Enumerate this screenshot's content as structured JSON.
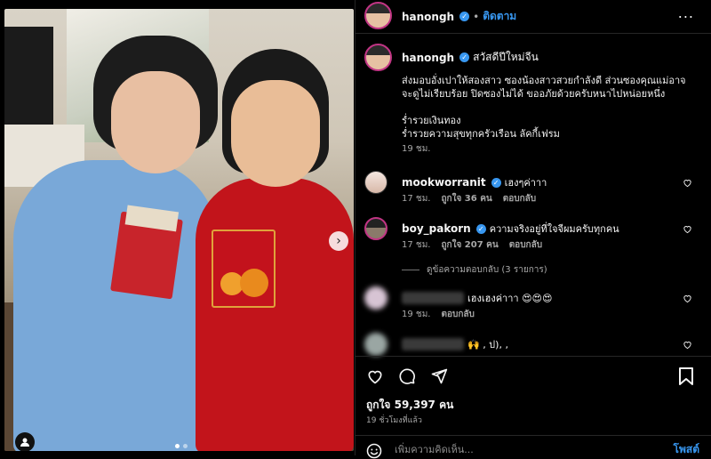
{
  "header": {
    "username": "hanongh",
    "separator": "•",
    "follow_label": "ติดตาม",
    "more_label": "..."
  },
  "caption": {
    "username": "hanongh",
    "title": "สวัสดีปีใหม่จีน",
    "body": "ส่งมอบอั่งเปาให้สองสาว ซองน้องสาวสวยกำลังดี ส่วนซองคุณแม่อาจจะดูไม่เรียบร้อย ปิดซองไม่ได้ ขออภัยด้วยครับหนาไปหน่อยหนึ่ง\n\nร่ำรวยเงินทอง\nร่ำรวยความสุขทุกครัวเรือน ลัคกี้เฟรม",
    "time": "19 ชม."
  },
  "comments": [
    {
      "username": "mookworranit",
      "text": "เฮงๆค่าาา",
      "time": "17 ชม.",
      "likes": "ถูกใจ 36 คน",
      "reply": "ตอบกลับ"
    },
    {
      "username": "boy_pakorn",
      "text": "ความจริงอยู่ที่ใจจีผมครับทุกคน",
      "time": "17 ชม.",
      "likes": "ถูกใจ 207 คน",
      "reply": "ตอบกลับ"
    },
    {
      "text": "เฮงเฮงค่าาา 😍😍😍",
      "time": "19 ชม.",
      "reply": "ตอบกลับ"
    },
    {
      "text": "🙌 , ป), ,"
    }
  ],
  "view_replies": "ดูข้อความตอบกลับ (3 รายการ)",
  "photo": {
    "next_label": "›"
  },
  "actions": {
    "likes": "ถูกใจ 59,397 คน",
    "post_time": "19 ชั่วโมงที่แล้ว",
    "comment_placeholder": "เพิ่มความคิดเห็น...",
    "post_label": "โพสต์"
  }
}
